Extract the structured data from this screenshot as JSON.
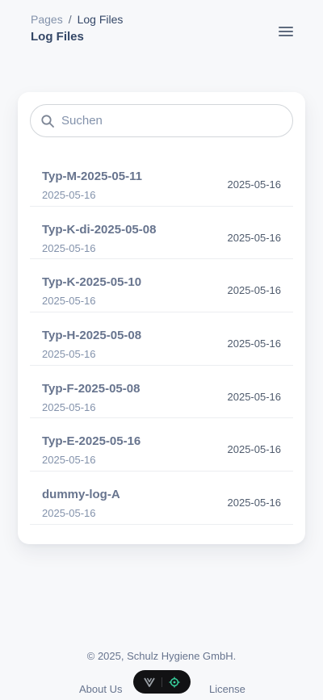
{
  "breadcrumb": {
    "parent": "Pages",
    "separator": "/",
    "current": "Log Files"
  },
  "header": {
    "title": "Log Files",
    "menu_icon": "hamburger-icon"
  },
  "search": {
    "placeholder": "Suchen",
    "value": "",
    "icon": "search-icon"
  },
  "logs": [
    {
      "name": "Typ-M-2025-05-11",
      "created": "2025-05-16",
      "date": "2025-05-16"
    },
    {
      "name": "Typ-K-di-2025-05-08",
      "created": "2025-05-16",
      "date": "2025-05-16"
    },
    {
      "name": "Typ-K-2025-05-10",
      "created": "2025-05-16",
      "date": "2025-05-16"
    },
    {
      "name": "Typ-H-2025-05-08",
      "created": "2025-05-16",
      "date": "2025-05-16"
    },
    {
      "name": "Typ-F-2025-05-08",
      "created": "2025-05-16",
      "date": "2025-05-16"
    },
    {
      "name": "Typ-E-2025-05-16",
      "created": "2025-05-16",
      "date": "2025-05-16"
    },
    {
      "name": "dummy-log-A",
      "created": "2025-05-16",
      "date": "2025-05-16"
    }
  ],
  "footer": {
    "copyright": "© 2025, Schulz Hygiene GmbH.",
    "about": "About Us",
    "license": "License"
  },
  "colors": {
    "background": "#f7f8fa",
    "title": "#344767",
    "muted": "#8392ab",
    "toolbar": "#121214",
    "toolbar_accent": "#38d39f"
  }
}
